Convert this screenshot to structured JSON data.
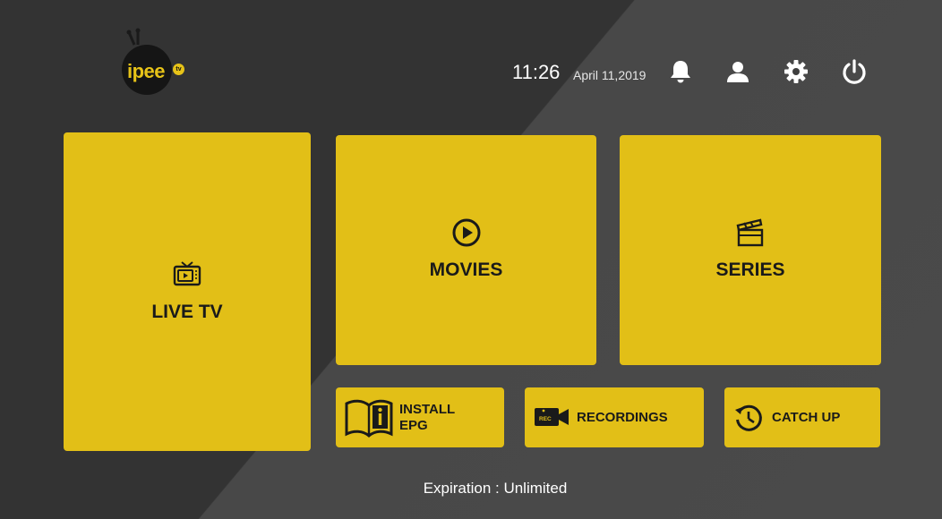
{
  "app": {
    "logo_text": "ipee",
    "logo_badge": "tv"
  },
  "header": {
    "time": "11:26",
    "date": "April 11,2019",
    "icons": [
      "bell-icon",
      "user-icon",
      "gear-icon",
      "power-icon"
    ]
  },
  "tiles": {
    "live_tv": "LIVE TV",
    "movies": "MOVIES",
    "series": "SERIES",
    "install_epg": "INSTALL\nEPG",
    "install_epg_line1": "INSTALL",
    "install_epg_line2": "EPG",
    "recordings": "RECORDINGS",
    "rec_badge": "REC",
    "catch_up": "CATCH UP"
  },
  "footer": {
    "expiration": "Expiration : Unlimited"
  },
  "colors": {
    "accent": "#e2bf17",
    "background_dark": "#333333",
    "background_light": "#4a4a4a",
    "text_on_tile": "#1a1a1a"
  }
}
